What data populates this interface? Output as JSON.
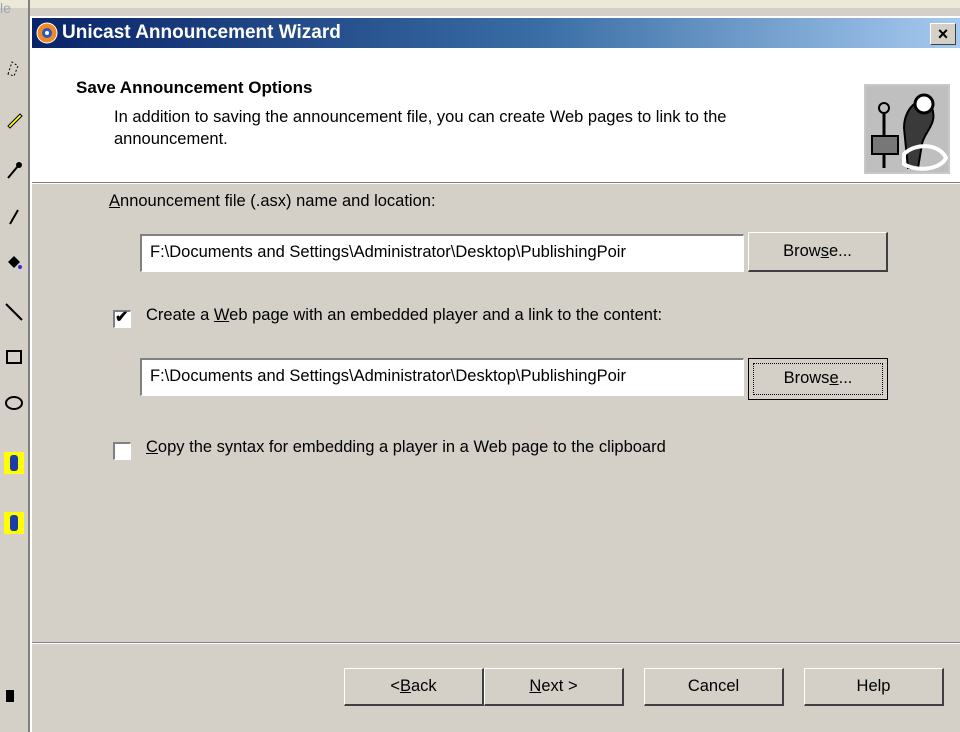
{
  "background": {
    "left_label": "le"
  },
  "window": {
    "title": "Unicast Announcement Wizard",
    "close_label": "×"
  },
  "header": {
    "title": "Save Announcement Options",
    "description": "In addition to saving the announcement file, you can create Web pages to link to the announcement."
  },
  "form": {
    "announcement_label_pre": "",
    "announcement_label_u": "A",
    "announcement_label_post": "nnouncement file (.asx) name and location:",
    "announcement_path": "F:\\Documents and Settings\\Administrator\\Desktop\\PublishingPoir",
    "browse1_pre": "Brow",
    "browse1_u": "s",
    "browse1_post": "e...",
    "webpage_checked": true,
    "webpage_label_pre": "Create a ",
    "webpage_label_u": "W",
    "webpage_label_post": "eb page with an embedded player and a link to the content:",
    "webpage_path": "F:\\Documents and Settings\\Administrator\\Desktop\\PublishingPoir",
    "browse2_pre": "Brows",
    "browse2_u": "e",
    "browse2_post": "...",
    "copy_checked": false,
    "copy_label_pre": "",
    "copy_label_u": "C",
    "copy_label_post": "opy the syntax for embedding a player in a Web page to the clipboard",
    "checkmark": "✔"
  },
  "footer": {
    "back_pre": "< ",
    "back_u": "B",
    "back_post": "ack",
    "next_u": "N",
    "next_post": "ext >",
    "cancel": "Cancel",
    "help": "Help"
  },
  "colors": {
    "title_gradient_start": "#0a246a",
    "title_gradient_end": "#a6caf0",
    "dialog_face": "#d4d0c8"
  }
}
